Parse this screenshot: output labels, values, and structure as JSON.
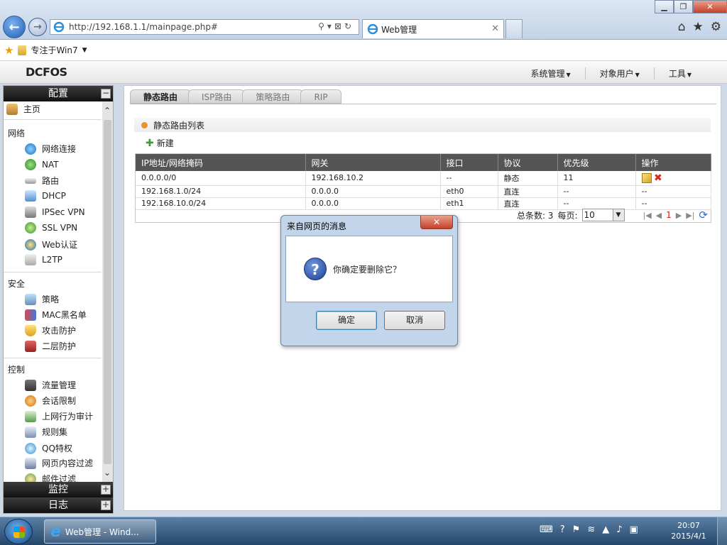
{
  "browser": {
    "url": "http://192.168.1.1/mainpage.php#",
    "tab_title": "Web管理",
    "favorites_label": "专注于Win7",
    "win_min": "▁",
    "win_max": "❐",
    "win_close": "✕"
  },
  "app": {
    "logo": "DCFOS",
    "top_menu": [
      "系统管理",
      "对象用户",
      "工具"
    ]
  },
  "sidebar": {
    "config_label": "配置",
    "home_label": "主页",
    "groups": [
      {
        "label": "网络",
        "items": [
          "网络连接",
          "NAT",
          "路由",
          "DHCP",
          "IPSec VPN",
          "SSL VPN",
          "Web认证",
          "L2TP"
        ]
      },
      {
        "label": "安全",
        "items": [
          "策略",
          "MAC黑名单",
          "攻击防护",
          "二层防护"
        ]
      },
      {
        "label": "控制",
        "items": [
          "流量管理",
          "会话限制",
          "上网行为审计",
          "规则集",
          "QQ特权",
          "网页内容过滤",
          "邮件过滤"
        ]
      }
    ],
    "monitor_label": "监控",
    "log_label": "日志"
  },
  "main": {
    "tabs": [
      "静态路由",
      "ISP路由",
      "策略路由",
      "RIP"
    ],
    "section_title": "静态路由列表",
    "new_label": "新建",
    "table": {
      "headers": [
        "IP地址/网络掩码",
        "网关",
        "接口",
        "协议",
        "优先级",
        "操作"
      ],
      "rows": [
        [
          "0.0.0.0/0",
          "192.168.10.2",
          "--",
          "静态",
          "11",
          ""
        ],
        [
          "192.168.1.0/24",
          "0.0.0.0",
          "eth0",
          "直连",
          "--",
          "--"
        ],
        [
          "192.168.10.0/24",
          "0.0.0.0",
          "eth1",
          "直连",
          "--",
          "--"
        ]
      ]
    },
    "pager": {
      "total_label": "总条数: 3",
      "per_page_label": "每页:",
      "per_page_value": "10",
      "current_page": "1"
    }
  },
  "dialog": {
    "title": "来自网页的消息",
    "message": "你确定要删除它？",
    "ok_label": "确定",
    "cancel_label": "取消"
  },
  "taskbar": {
    "task_label": "Web管理 - Wind...",
    "time": "20:07",
    "date": "2015/4/1"
  }
}
